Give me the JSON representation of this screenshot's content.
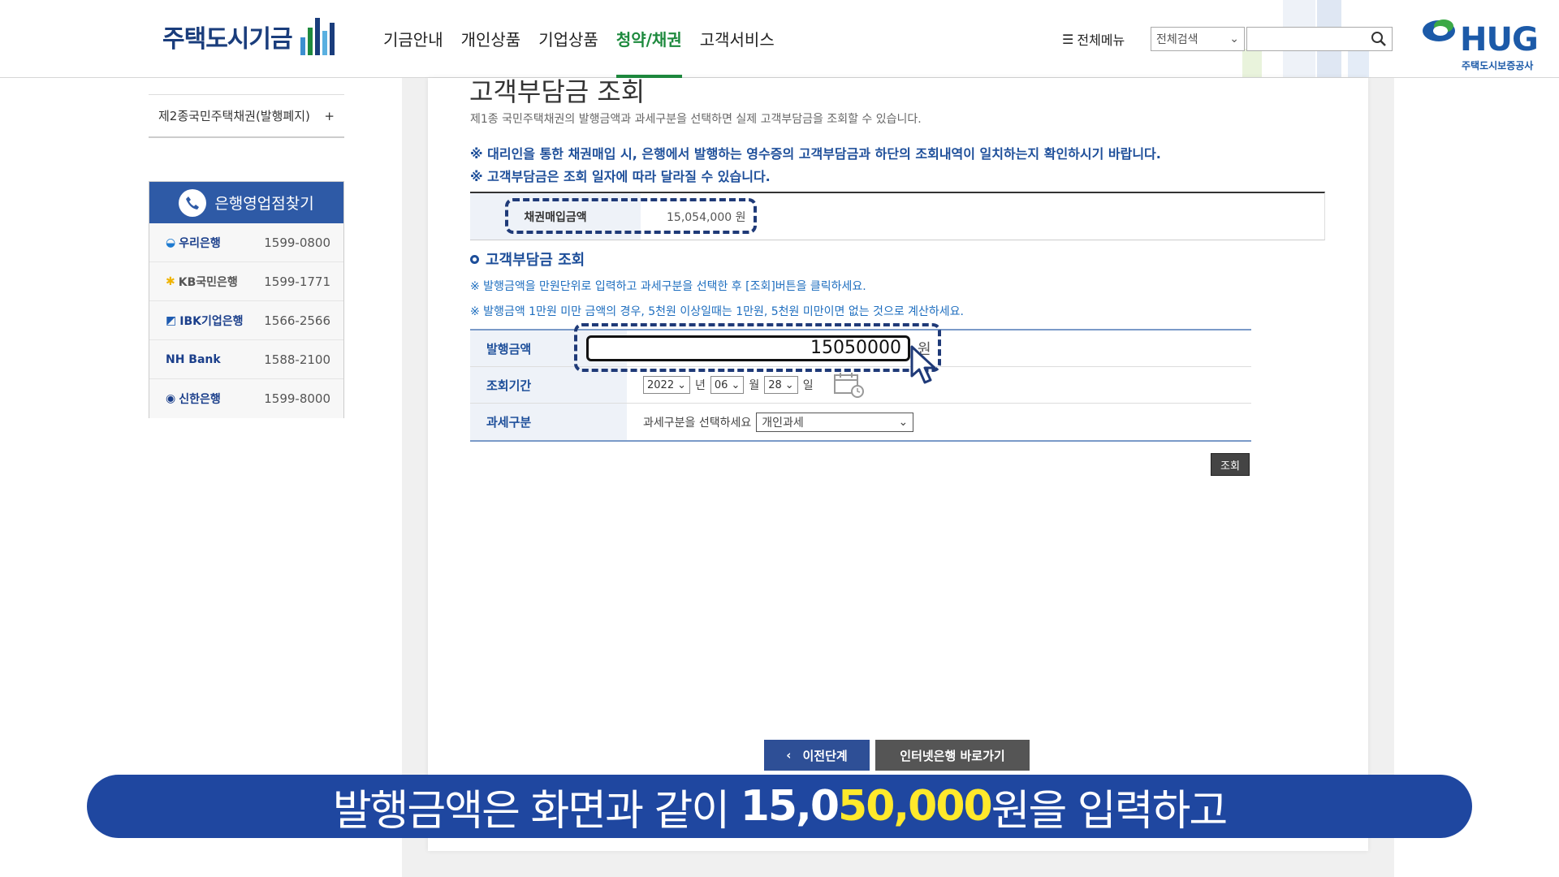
{
  "header": {
    "logo_text": "주택도시기금",
    "nav": [
      "기금안내",
      "개인상품",
      "기업상품",
      "청약/채권",
      "고객서비스"
    ],
    "active_nav": "청약/채권",
    "all_menu": "전체메뉴",
    "search_scope": "전체검색",
    "search_value": "",
    "brand": "HUG",
    "brand_sub": "주택도시보증공사",
    "colors": {
      "primary": "#1f47a0",
      "active": "#1e8a3e",
      "brand": "#1c5aa8"
    }
  },
  "sidebar": {
    "menu_item": "제2종국민주택채권(발행폐지)",
    "menu_toggle": "+",
    "bank_finder_title": "은행영업점찾기",
    "banks": [
      {
        "name": "우리은행",
        "phone": "1599-0800"
      },
      {
        "name": "KB국민은행",
        "phone": "1599-1771"
      },
      {
        "name": "IBK기업은행",
        "phone": "1566-2566"
      },
      {
        "name": "NH Bank",
        "phone": "1588-2100"
      },
      {
        "name": "신한은행",
        "phone": "1599-8000"
      }
    ]
  },
  "main": {
    "title": "고객부담금 조회",
    "desc": "제1종 국민주택채권의 발행금액과 과세구분을 선택하면 실제 고객부담금을 조회할 수 있습니다.",
    "notices": [
      "※ 대리인을 통한 채권매입 시, 은행에서 발행하는 영수증의 고객부담금과 하단의 조회내역이 일치하는지 확인하시기 바랍니다.",
      "※ 고객부담금은 조회 일자에 따라 달라질 수 있습니다."
    ],
    "bond_label": "채권매입금액",
    "bond_value": "15,054,000 원",
    "section_title": "고객부담금 조회",
    "guides": [
      "※ 발행금액을 만원단위로 입력하고 과세구분을 선택한 후 [조회]버튼을 클릭하세요.",
      "※ 발행금액 1만원 미만 금액의 경우, 5천원 이상일때는 1만원, 5천원 미만이면 없는 것으로 계산하세요."
    ],
    "form": {
      "amount_label": "발행금액",
      "amount_value": "15050000",
      "amount_unit": "원",
      "date_label": "조회기간",
      "year": "2022",
      "year_unit": "년",
      "month": "06",
      "month_unit": "월",
      "day": "28",
      "day_unit": "일",
      "tax_label": "과세구분",
      "tax_prompt": "과세구분을 선택하세요",
      "tax_value": "개인과세"
    },
    "query_button": "조회",
    "prev_button": "이전단계",
    "bank_button": "인터넷은행 바로가기"
  },
  "caption": {
    "before": "발행금액은 화면과 같이 ",
    "bold_part": "15,0",
    "highlight": "50,000",
    "after": "원을 입력하고"
  }
}
